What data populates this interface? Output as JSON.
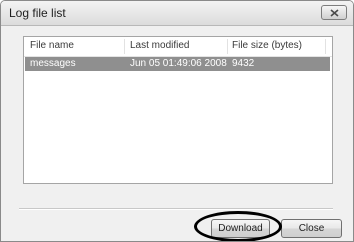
{
  "window": {
    "title": "Log file list"
  },
  "list": {
    "columns": [
      "File name",
      "Last modified",
      "File size (bytes)"
    ],
    "rows": [
      {
        "file_name": "messages",
        "last_modified": "Jun 05 01:49:06 2008",
        "file_size": "9432",
        "selected": true
      }
    ]
  },
  "buttons": {
    "download": "Download",
    "close": "Close"
  },
  "icons": {
    "title_close": "close-icon"
  }
}
